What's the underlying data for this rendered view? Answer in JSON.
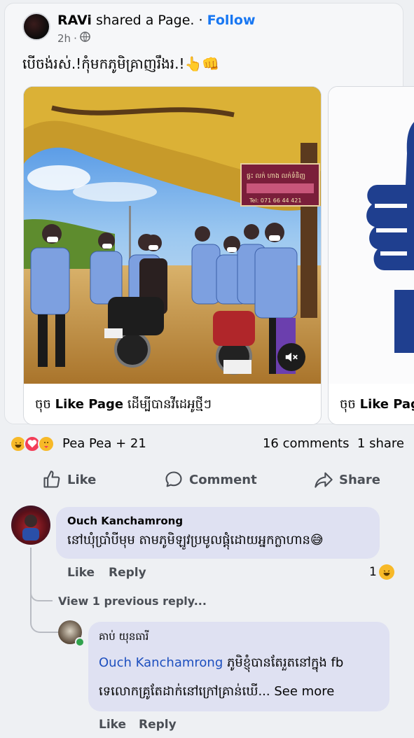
{
  "post": {
    "author": "RAVi",
    "action_text": "shared a Page.",
    "separator": "·",
    "follow_label": "Follow",
    "time": "2h",
    "meta_separator": "·",
    "audience_icon": "globe-icon",
    "caption": "បើចង់រស់.!កុំមកភូមិគ្រាញរឹងរ.!👆👊",
    "carousel": [
      {
        "cta_prefix": "ចុច",
        "cta_bold": "Like Page",
        "cta_suffix": "ដើម្បីបានវីដេអូថ្មីៗ",
        "sign_text": "ផ្ទះ លក់ ហាង លក់ទំនិញ",
        "sign_phone": "Tel: 071 66 44 421"
      },
      {
        "cta_prefix": "ចុច",
        "cta_bold": "Like Pag"
      }
    ]
  },
  "stats": {
    "reaction_names": "Pea Pea + 21",
    "comments": "16 comments",
    "shares": "1 share"
  },
  "actions": {
    "like": "Like",
    "comment": "Comment",
    "share": "Share"
  },
  "comments": [
    {
      "author": "Ouch Kanchamrong",
      "text": "នៅឃុំប្រាំបីមុម តាមភូមិឡូវប្រមូលផ្តុំដោយអ្នកក្លាហាន😅",
      "like": "Like",
      "reply": "Reply",
      "reaction_count": "1",
      "view_previous": "View 1 previous reply..."
    },
    {
      "author": "គាប់ យុនធារី",
      "mention": "Ouch Kanchamrong",
      "text_line1": "ភូមិខ្ញុំបានតែរួតនៅក្នុង fb",
      "text_line2": "ទេលោកគ្រូតែដាក់នៅក្រៅគ្រាន់ឃើ...",
      "see_more": "See more",
      "like": "Like",
      "reply": "Reply"
    }
  ],
  "colors": {
    "accent": "#1877f2",
    "bubble": "#dfe1f2",
    "background": "#eef0f3"
  }
}
